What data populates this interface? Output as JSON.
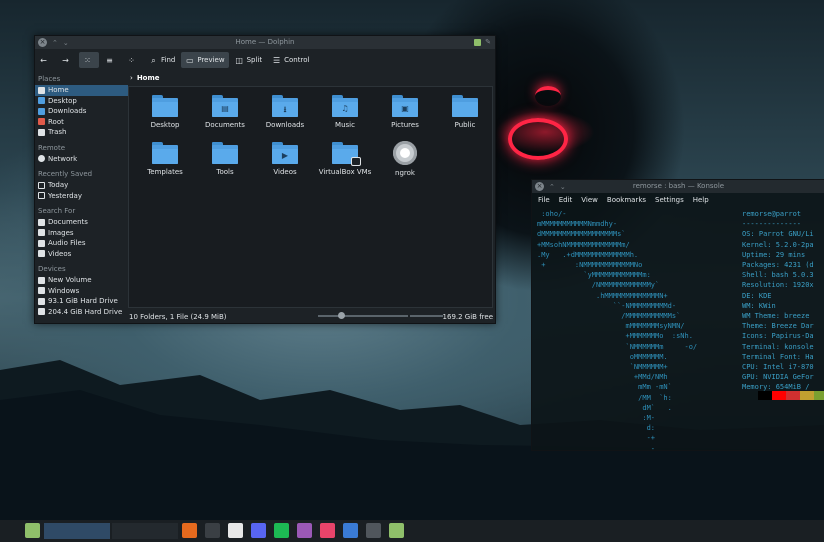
{
  "dolphin": {
    "title": "Home — Dolphin",
    "toolbar": {
      "find": "Find",
      "preview": "Preview",
      "split": "Split",
      "control": "Control"
    },
    "breadcrumb": "Home",
    "sidebar": {
      "places_header": "Places",
      "places": [
        "Home",
        "Desktop",
        "Downloads",
        "Root",
        "Trash"
      ],
      "remote_header": "Remote",
      "remote": [
        "Network"
      ],
      "recent_header": "Recently Saved",
      "recent": [
        "Today",
        "Yesterday"
      ],
      "search_header": "Search For",
      "search": [
        "Documents",
        "Images",
        "Audio Files",
        "Videos"
      ],
      "devices_header": "Devices",
      "devices": [
        "New Volume",
        "Windows",
        "93.1 GiB Hard Drive",
        "204.4 GiB Hard Drive"
      ]
    },
    "items": [
      {
        "label": "Desktop",
        "icon": "folder-desktop-icon",
        "glyph": ""
      },
      {
        "label": "Documents",
        "icon": "folder-documents-icon",
        "glyph": "▤"
      },
      {
        "label": "Downloads",
        "icon": "folder-downloads-icon",
        "glyph": "⭳"
      },
      {
        "label": "Music",
        "icon": "folder-music-icon",
        "glyph": "♫"
      },
      {
        "label": "Pictures",
        "icon": "folder-pictures-icon",
        "glyph": "▣"
      },
      {
        "label": "Public",
        "icon": "folder-public-icon",
        "glyph": ""
      },
      {
        "label": "Templates",
        "icon": "folder-templates-icon",
        "glyph": ""
      },
      {
        "label": "Tools",
        "icon": "folder-tools-icon",
        "glyph": ""
      },
      {
        "label": "Videos",
        "icon": "folder-videos-icon",
        "glyph": "▶"
      },
      {
        "label": "VirtualBox VMs",
        "icon": "folder-locked-icon",
        "glyph": ""
      },
      {
        "label": "ngrok",
        "icon": "executable-gear-icon",
        "glyph": ""
      }
    ],
    "status": {
      "summary": "10 Folders, 1 File (24.9 MiB)",
      "free": "169.2 GiB free"
    }
  },
  "konsole": {
    "title": "remorse : bash — Konsole",
    "menu": [
      "File",
      "Edit",
      "View",
      "Bookmarks",
      "Settings",
      "Help"
    ],
    "art": [
      " :oho/-",
      "mMMMMMMMMMMMNmmdhy-",
      "dMMMMMMMMMMMMMMMMMMs`",
      "+MMsohNMMMMMMMMMMMMMm/",
      ".My   .+dMMMMMMMMMMMMMh.",
      " +       :NMMMMMMMMMMMMNo",
      "           `yMMMMMMMMMMMMm:",
      "             /NMMMMMMMMMMMMy`",
      "              .hMMMMMMMMMMMMMN+",
      "                  ``-NMMMMMMMMMd-",
      "                    /MMMMMMMMMMMs`",
      "                     mMMMMMMMsyNMN/",
      "                     +MMMMMMMo  :sNh.",
      "                     `NMMMMMMm     -o/",
      "                      oMMMMMMM.",
      "                      `NMMMMMM+",
      "                       +MMd/NMh",
      "                        mMm -mN`",
      "                        /MM  `h:",
      "                         dM`   .",
      "                         :M-",
      "                          d:",
      "                          -+",
      "                           -"
    ],
    "info": [
      "remorse@parrot",
      "--------------",
      "OS: Parrot GNU/Li",
      "Kernel: 5.2.0-2pa",
      "Uptime: 29 mins",
      "Packages: 4231 (d",
      "Shell: bash 5.0.3",
      "Resolution: 1920x",
      "DE: KDE",
      "WM: KWin",
      "WM Theme: breeze",
      "Theme: Breeze Dar",
      "Icons: Papirus-Da",
      "Terminal: konsole",
      "Terminal Font: Ha",
      "CPU: Intel i7-870",
      "GPU: NVIDIA GeFor",
      "Memory: 654MiB /"
    ],
    "palette": [
      "#000000",
      "#ff0000",
      "#d03030",
      "#c0a030",
      "#7aa030",
      "#3aa040",
      "#e040c0"
    ]
  },
  "taskbar": {
    "apps": [
      {
        "name": "firefox-icon",
        "color": "#e66a1e"
      },
      {
        "name": "terminal-icon",
        "color": "#3a3f44"
      },
      {
        "name": "text-editor-icon",
        "color": "#e8e8e8"
      },
      {
        "name": "discord-icon",
        "color": "#5865f2"
      },
      {
        "name": "spotify-icon",
        "color": "#1db954"
      },
      {
        "name": "mosaic-app-icon",
        "color": "#9b59b6"
      },
      {
        "name": "media-player-icon",
        "color": "#e9446a"
      },
      {
        "name": "code-editor-icon",
        "color": "#3a7bd5"
      },
      {
        "name": "console-icon",
        "color": "#50565c"
      },
      {
        "name": "file-manager-icon",
        "color": "#8fbf6a"
      }
    ]
  }
}
